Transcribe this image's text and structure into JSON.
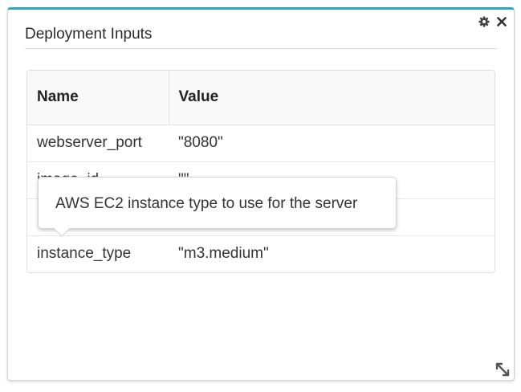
{
  "widget": {
    "title": "Deployment Inputs",
    "actions": {
      "settings_icon": "gear-icon",
      "close_icon": "close-icon"
    },
    "accent_color": "#29a8c9"
  },
  "table": {
    "headers": {
      "name": "Name",
      "value": "Value"
    },
    "rows": [
      {
        "name": "webserver_port",
        "value": "\"8080\""
      },
      {
        "name": "image_id",
        "value": "\"\""
      },
      {
        "name": "",
        "value": ""
      },
      {
        "name": "instance_type",
        "value": "\"m3.medium\""
      }
    ]
  },
  "tooltip": {
    "text": "AWS EC2 instance type to use for the server"
  }
}
